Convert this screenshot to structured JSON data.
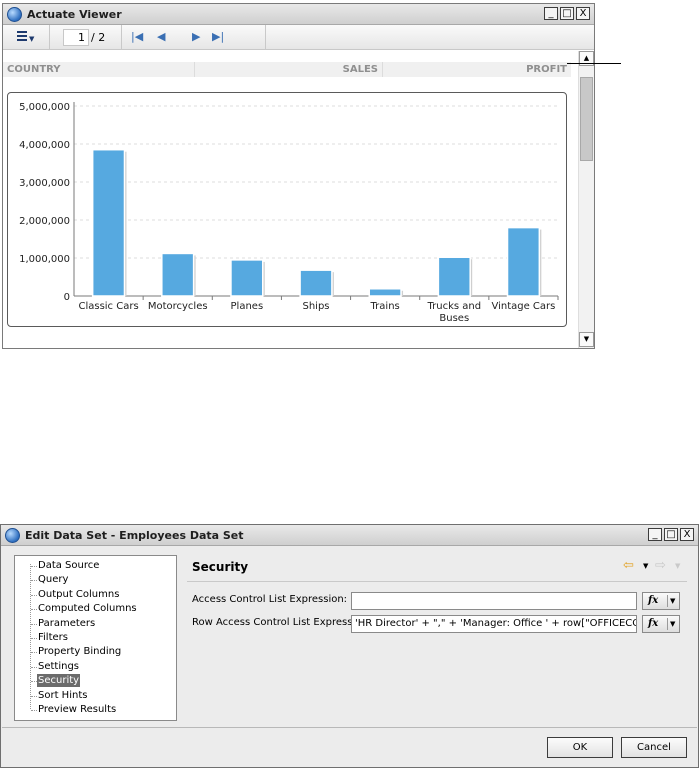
{
  "viewer": {
    "title": "Actuate Viewer",
    "window_buttons": [
      "_",
      "□",
      "X"
    ],
    "toolbar": {
      "menu_icon": "menu-list-icon",
      "page_current": "1",
      "page_total": "/ 2",
      "nav_icons": [
        "first-page-icon",
        "previous-page-icon",
        "next-page-icon",
        "last-page-icon"
      ]
    },
    "columns": [
      "COUNTRY",
      "SALES",
      "PROFIT"
    ]
  },
  "chart_data": {
    "type": "bar",
    "categories": [
      "Classic Cars",
      "Motorcycles",
      "Planes",
      "Ships",
      "Trains",
      "Trucks and Buses",
      "Vintage Cars"
    ],
    "values": [
      3850000,
      1120000,
      950000,
      680000,
      190000,
      1020000,
      1800000
    ],
    "ylim": [
      0,
      5000000
    ],
    "yticks": [
      "0",
      "1,000,000",
      "2,000,000",
      "3,000,000",
      "4,000,000",
      "5,000,000"
    ],
    "grid": true,
    "bar_color": "#56a9e0",
    "title": "",
    "xlabel": "",
    "ylabel": ""
  },
  "dialog": {
    "title": "Edit Data Set - Employees Data Set",
    "window_buttons": [
      "_",
      "□",
      "X"
    ],
    "tree": [
      "Data Source",
      "Query",
      "Output Columns",
      "Computed Columns",
      "Parameters",
      "Filters",
      "Property Binding",
      "Settings",
      "Security",
      "Sort Hints",
      "Preview Results"
    ],
    "selected": "Security",
    "pane_title": "Security",
    "fields": [
      {
        "label": "Access Control List Expression:",
        "value": "",
        "fx": "fx"
      },
      {
        "label": "Row Access Control List Expression:",
        "value": "'HR Director' + \",\" + 'Manager: Office ' + row[\"OFFICECODE\"]",
        "fx": "fx"
      }
    ],
    "ok_label": "OK",
    "cancel_label": "Cancel"
  }
}
